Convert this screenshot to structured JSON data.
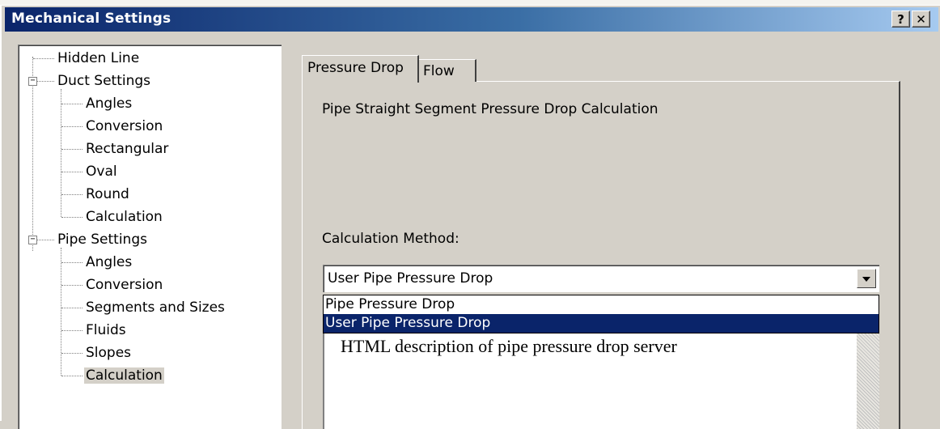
{
  "window": {
    "title": "Mechanical Settings",
    "help_label": "?",
    "close_label": "✕"
  },
  "tree": {
    "items": [
      {
        "label": "Hidden Line"
      },
      {
        "label": "Duct Settings",
        "expander": "−"
      },
      {
        "label": "Angles"
      },
      {
        "label": "Conversion"
      },
      {
        "label": "Rectangular"
      },
      {
        "label": "Oval"
      },
      {
        "label": "Round"
      },
      {
        "label": "Calculation"
      },
      {
        "label": "Pipe Settings",
        "expander": "−"
      },
      {
        "label": "Angles"
      },
      {
        "label": "Conversion"
      },
      {
        "label": "Segments and Sizes"
      },
      {
        "label": "Fluids"
      },
      {
        "label": "Slopes"
      },
      {
        "label": "Calculation",
        "selected": true
      }
    ]
  },
  "tabs": [
    {
      "label": "Pressure Drop",
      "active": true
    },
    {
      "label": "Flow",
      "active": false
    }
  ],
  "panel": {
    "heading": "Pipe Straight Segment Pressure Drop Calculation",
    "method_label": "Calculation Method:",
    "method_value": "User Pipe Pressure Drop",
    "options": [
      "Pipe Pressure Drop",
      "User Pipe Pressure Drop"
    ],
    "selected_option": "User Pipe Pressure Drop",
    "description": "HTML description of pipe pressure drop server"
  }
}
